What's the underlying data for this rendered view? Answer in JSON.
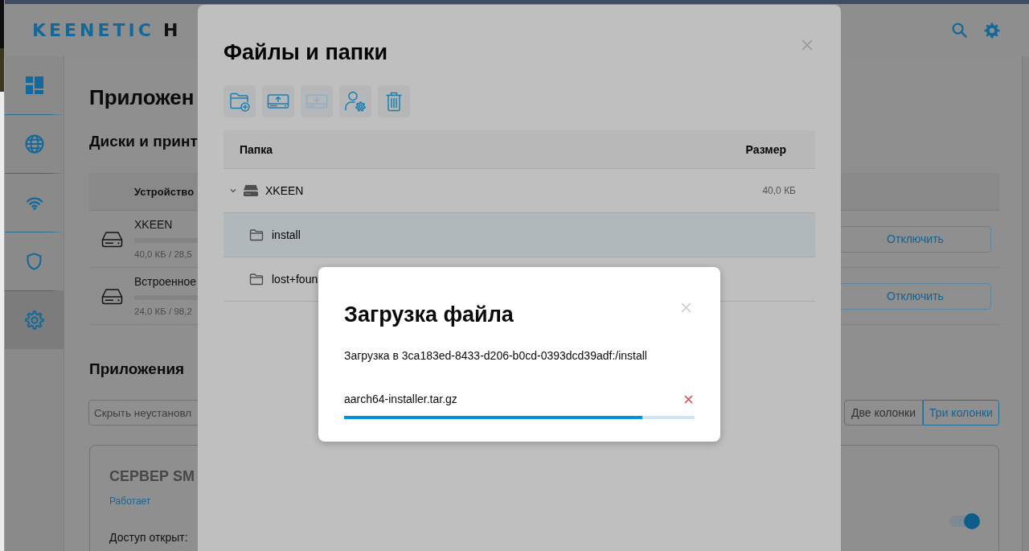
{
  "header": {
    "logo": {
      "brand": "KEENETIC",
      "model": "H"
    }
  },
  "sidebar": {
    "items": [
      {
        "kind": "dashboard",
        "selected": false
      },
      {
        "kind": "internet",
        "selected": false
      },
      {
        "kind": "wifi",
        "selected": false
      },
      {
        "kind": "security",
        "selected": false
      },
      {
        "kind": "settings",
        "selected": true
      }
    ]
  },
  "page": {
    "title": "Приложен",
    "disks": {
      "title": "Диски и принт",
      "columns": [
        "Устройство"
      ],
      "rows": [
        {
          "name": "XKEEN",
          "usage": "40,0 КБ / 28,5",
          "action": "Отключить"
        },
        {
          "name": "Встроенное",
          "usage": "24,0 КБ / 98,2",
          "action": "Отключить"
        }
      ]
    },
    "apps": {
      "title": "Приложения",
      "filter": {
        "value": "Скрыть неустановл"
      },
      "layout_options": [
        {
          "label": "Две колонки",
          "selected": false
        },
        {
          "label": "Три колонки",
          "selected": true
        }
      ],
      "cards": [
        {
          "title": "СЕРВЕР SM",
          "status": "Работает",
          "field_label": "Доступ открыт:",
          "on": true
        }
      ]
    }
  },
  "files_dialog": {
    "title": "Файлы и папки",
    "toolbar": [
      {
        "kind": "new-folder",
        "disabled": false
      },
      {
        "kind": "upload",
        "disabled": false
      },
      {
        "kind": "download",
        "disabled": true
      },
      {
        "kind": "permissions",
        "disabled": false
      },
      {
        "kind": "delete",
        "disabled": false
      }
    ],
    "columns": [
      "Папка",
      "Размер"
    ],
    "tree": [
      {
        "kind": "drive",
        "name": "XKEEN",
        "size": "40,0 КБ",
        "expanded": true,
        "selected": false,
        "children": [
          {
            "kind": "folder",
            "name": "install",
            "selected": true
          },
          {
            "kind": "folder",
            "name": "lost+foun",
            "selected": false
          }
        ]
      }
    ]
  },
  "upload_dialog": {
    "title": "Загрузка файла",
    "destination": "Загрузка в 3ca183ed-8433-d206-b0cd-0393dcd39adf:/install",
    "files": [
      {
        "name": "aarch64-installer.tar.gz",
        "level": 0.85
      }
    ]
  }
}
